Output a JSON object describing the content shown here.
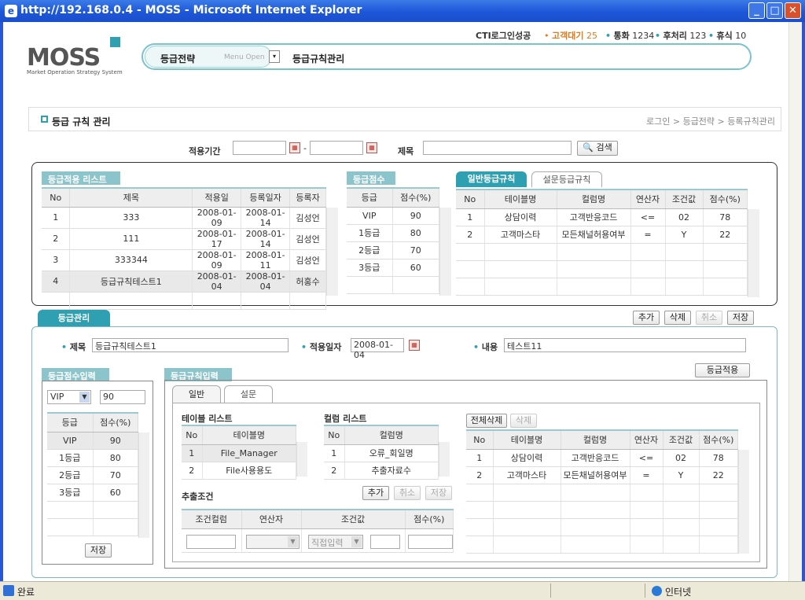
{
  "window": {
    "title": "http://192.168.0.4 - MOSS - Microsoft Internet Explorer",
    "status": "완료",
    "zone": "인터넷"
  },
  "logo": {
    "text": "MOSS",
    "subtitle": "Market Operation Strategy System"
  },
  "topinfo": {
    "cti": "CTI로그인성공",
    "waiting_label": "고객대기",
    "waiting": "25",
    "call_label": "통화",
    "call": "1234",
    "after_label": "후처리",
    "after": "123",
    "rest_label": "휴식",
    "rest": "10"
  },
  "menu": {
    "main": "등급전략",
    "open": "Menu Open",
    "current": "등급규칙관리"
  },
  "page": {
    "title": "등급 규칙 관리",
    "breadcrumb": "로그인 > 등급전략 > 등록규칙관리"
  },
  "search": {
    "period_label": "적용기간",
    "dash": "-",
    "title_label": "제목",
    "button": "검색"
  },
  "list": {
    "tab": "등급적용 리스트",
    "headers": [
      "No",
      "제목",
      "적용일",
      "등록일자",
      "등록자"
    ],
    "rows": [
      [
        "1",
        "333",
        "2008-01-09",
        "2008-01-14",
        "김성언"
      ],
      [
        "2",
        "111",
        "2008-01-17",
        "2008-01-14",
        "김성언"
      ],
      [
        "3",
        "333344",
        "2008-01-09",
        "2008-01-11",
        "김성언"
      ],
      [
        "4",
        "등급규칙테스트1",
        "2008-01-04",
        "2008-01-04",
        "허홍수"
      ]
    ]
  },
  "score": {
    "tab": "등급점수",
    "headers": [
      "등급",
      "점수(%)"
    ],
    "rows": [
      [
        "VIP",
        "90"
      ],
      [
        "1등급",
        "80"
      ],
      [
        "2등급",
        "70"
      ],
      [
        "3등급",
        "60"
      ]
    ]
  },
  "rules": {
    "tab_on": "일반등급규칙",
    "tab_off": "설문등급규칙",
    "headers": [
      "No",
      "테이블명",
      "컬럼명",
      "연산자",
      "조건값",
      "점수(%)"
    ],
    "rows": [
      [
        "1",
        "상담이력",
        "고객반응코드",
        "<=",
        "02",
        "78"
      ],
      [
        "2",
        "고객마스타",
        "모든채널허용여부",
        "=",
        "Y",
        "22"
      ]
    ]
  },
  "mgmt": {
    "tab": "등급관리",
    "btn_add": "추가",
    "btn_del": "삭제",
    "btn_cancel": "취소",
    "btn_save": "저장",
    "title_label": "제목",
    "title_value": "등급규칙테스트1",
    "date_label": "적용일자",
    "date_value": "2008-01-04",
    "content_label": "내용",
    "content_value": "테스트11"
  },
  "scoreinput": {
    "tab": "등급점수입력",
    "select": "VIP",
    "value": "90",
    "headers": [
      "등급",
      "점수(%)"
    ],
    "rows": [
      [
        "VIP",
        "90"
      ],
      [
        "1등급",
        "80"
      ],
      [
        "2등급",
        "70"
      ],
      [
        "3등급",
        "60"
      ]
    ],
    "save": "저장"
  },
  "ruleinput": {
    "tab": "등급규칙입력",
    "apply": "등급적용",
    "tab_general": "일반",
    "tab_survey": "설문",
    "table_list": "테이블 리스트",
    "table_headers": [
      "No",
      "테이블명"
    ],
    "table_rows": [
      [
        "1",
        "File_Manager"
      ],
      [
        "2",
        "File사용용도"
      ]
    ],
    "column_list": "컬럼 리스트",
    "column_headers": [
      "No",
      "컬럼명"
    ],
    "column_rows": [
      [
        "1",
        "오류_회일명"
      ],
      [
        "2",
        "추출자료수"
      ]
    ],
    "extract_label": "추출조건",
    "btn_add": "추가",
    "btn_cancel": "취소",
    "btn_save": "저장",
    "cond_headers": [
      "조건컬럼",
      "연산자",
      "조건값",
      "점수(%)"
    ],
    "cond_select": "직접입력",
    "btn_delete_all": "전체삭제",
    "btn_delete": "삭제",
    "rule_headers": [
      "No",
      "테이블명",
      "컬럼명",
      "연산자",
      "조건값",
      "점수(%)"
    ],
    "rule_rows": [
      [
        "1",
        "상담이력",
        "고객반응코드",
        "<=",
        "02",
        "78"
      ],
      [
        "2",
        "고객마스타",
        "모든채널허용여부",
        "=",
        "Y",
        "22"
      ]
    ]
  }
}
